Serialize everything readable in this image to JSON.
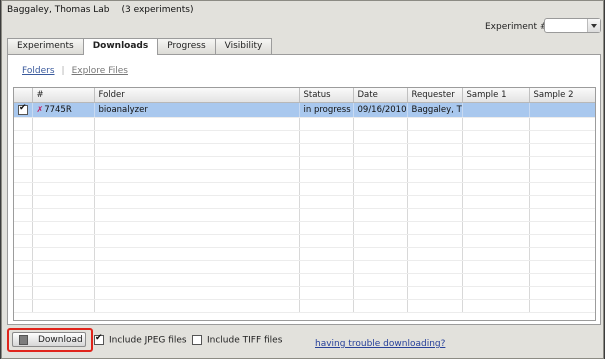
{
  "header": {
    "lab_name": "Baggaley, Thomas Lab",
    "experiment_count": "(3 experiments)",
    "experiment_label": "Experiment #",
    "experiment_value": ""
  },
  "tabs": [
    {
      "label": "Experiments",
      "active": false
    },
    {
      "label": "Downloads",
      "active": true
    },
    {
      "label": "Progress",
      "active": false
    },
    {
      "label": "Visibility",
      "active": false
    }
  ],
  "subnav": {
    "folders": "Folders",
    "separator": "|",
    "explore": "Explore Files"
  },
  "grid": {
    "columns": [
      "",
      "#",
      "Folder",
      "Status",
      "Date",
      "Requester",
      "Sample 1",
      "Sample 2"
    ],
    "rows": [
      {
        "checked": true,
        "number": "7745R",
        "folder": "bioanalyzer",
        "status": "in progress",
        "date": "09/16/2010",
        "requester": "Baggaley, T",
        "sample1": "",
        "sample2": ""
      }
    ]
  },
  "footer": {
    "download_label": "Download",
    "include_jpeg": {
      "label": "Include JPEG files",
      "checked": true
    },
    "include_tiff": {
      "label": "Include TIFF files",
      "checked": false
    },
    "trouble_link": "having trouble downloading?"
  },
  "colors": {
    "highlight_outline": "#e0241b",
    "selected_row": "#a9c8ee",
    "link": "#3a5a9c"
  }
}
